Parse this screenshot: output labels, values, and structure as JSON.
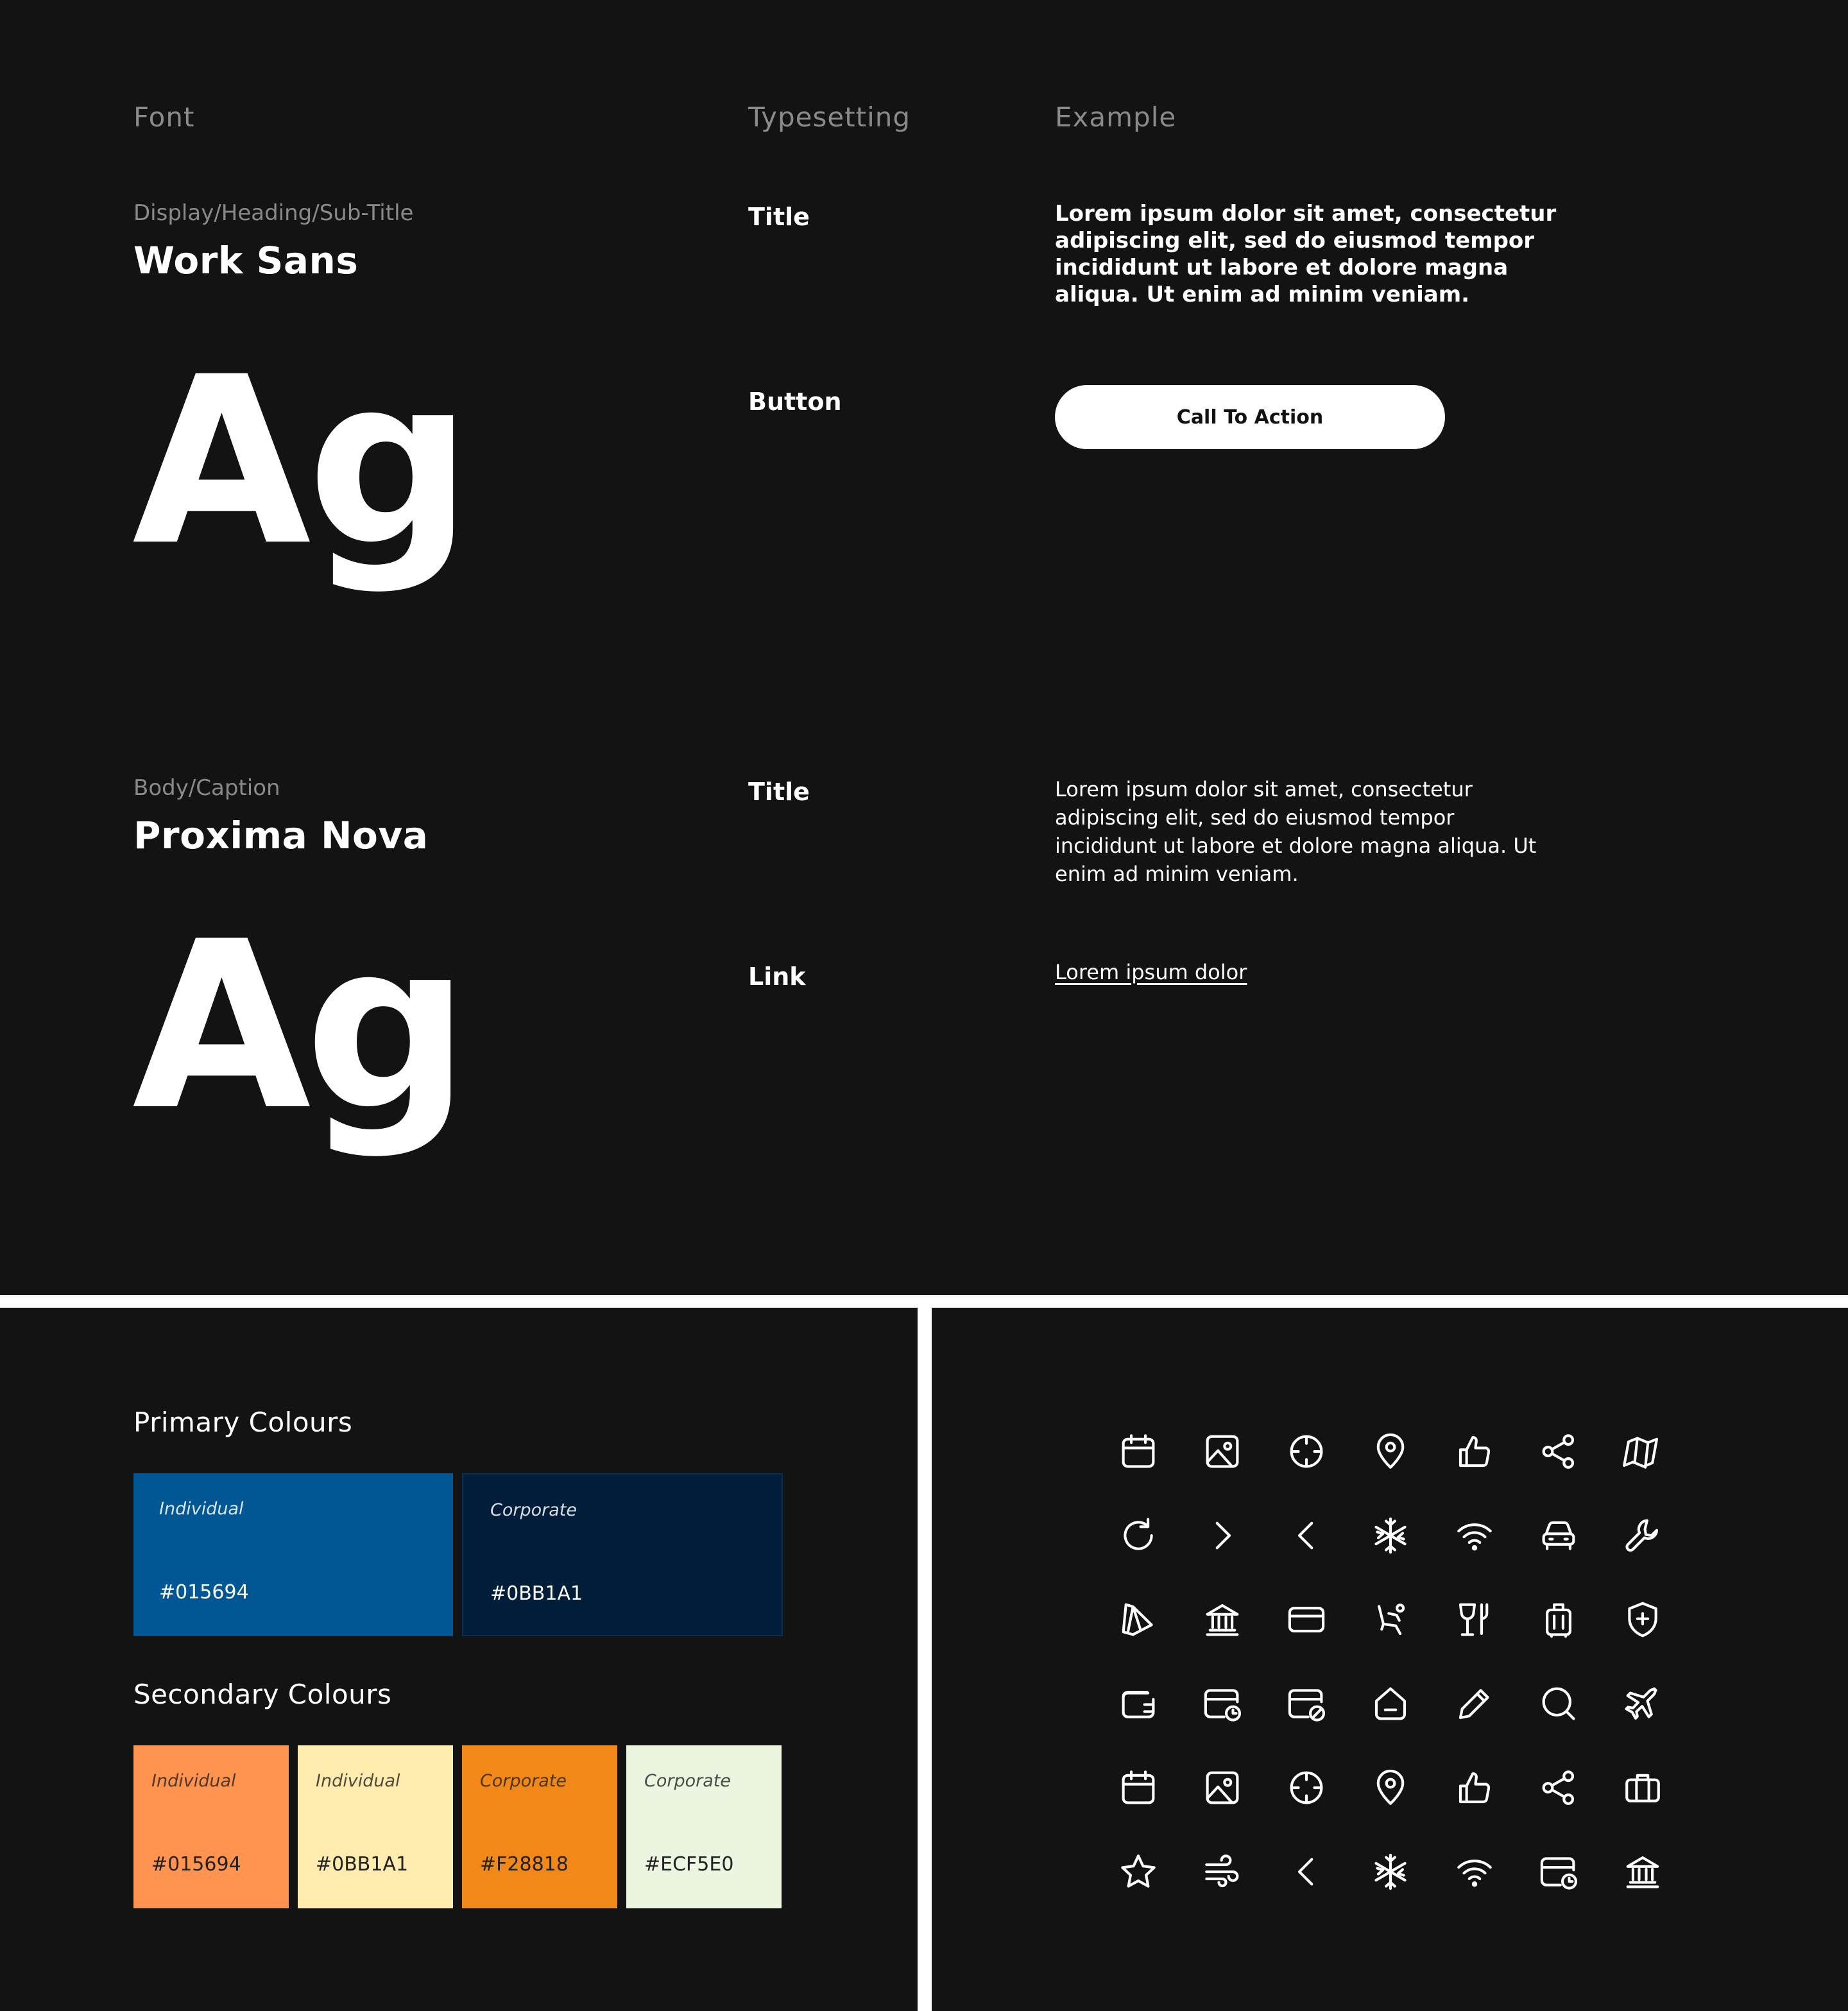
{
  "typography": {
    "headers": {
      "font": "Font",
      "typesetting": "Typesetting",
      "example": "Example"
    },
    "primary_font": {
      "category": "Display/Heading/Sub-Title",
      "name": "Work Sans",
      "sample": "Ag",
      "rows": [
        {
          "label": "Title",
          "example": "Lorem ipsum dolor sit amet, consectetur adipiscing elit, sed do eiusmod tempor incididunt ut labore et dolore magna aliqua. Ut enim ad minim veniam."
        },
        {
          "label": "Button",
          "button_text": "Call To Action"
        }
      ]
    },
    "secondary_font": {
      "category": "Body/Caption",
      "name": "Proxima Nova",
      "sample": "Ag",
      "rows": [
        {
          "label": "Title",
          "example": "Lorem ipsum dolor sit amet, consectetur adipiscing elit, sed do eiusmod tempor incididunt ut labore et dolore magna aliqua. Ut enim ad minim veniam."
        },
        {
          "label": "Link",
          "link_text": "Lorem ipsum dolor"
        }
      ]
    }
  },
  "colours": {
    "primary_title": "Primary Colours",
    "primary": [
      {
        "label": "Individual",
        "hex": "#015694",
        "color": "#015694"
      },
      {
        "label": "Corporate",
        "hex": "#0BB1A1",
        "color": "#001E3A"
      }
    ],
    "secondary_title": "Secondary Colours",
    "secondary": [
      {
        "label": "Individual",
        "hex": "#015694",
        "color": "#FF9350"
      },
      {
        "label": "Individual",
        "hex": "#0BB1A1",
        "color": "#FFECAE"
      },
      {
        "label": "Corporate",
        "hex": "#F28818",
        "color": "#F28818"
      },
      {
        "label": "Corporate",
        "hex": "#ECF5E0",
        "color": "#ECF5E0"
      }
    ]
  },
  "icons": [
    [
      "calendar-icon",
      "image-icon",
      "crosshair-icon",
      "map-pin-icon",
      "thumbs-up-icon",
      "share-icon",
      "map-icon"
    ],
    [
      "refresh-icon",
      "chevron-right-icon",
      "chevron-left-icon",
      "snowflake-icon",
      "wifi-icon",
      "car-icon",
      "wrench-icon"
    ],
    [
      "tag-arrow-icon",
      "bank-icon",
      "credit-card-icon",
      "seat-icon",
      "drinks-icon",
      "luggage-icon",
      "shield-plus-icon"
    ],
    [
      "wallet-icon",
      "card-clock-icon",
      "card-blocked-icon",
      "home-icon",
      "pencil-icon",
      "search-icon",
      "plane-icon"
    ],
    [
      "calendar-icon",
      "image-icon",
      "crosshair-icon",
      "map-pin-icon",
      "thumbs-up-icon",
      "share-icon",
      "briefcase-icon"
    ],
    [
      "star-icon",
      "wind-icon",
      "chevron-left-icon",
      "snowflake-icon",
      "wifi-icon",
      "card-clock-icon",
      "bank-icon"
    ]
  ]
}
